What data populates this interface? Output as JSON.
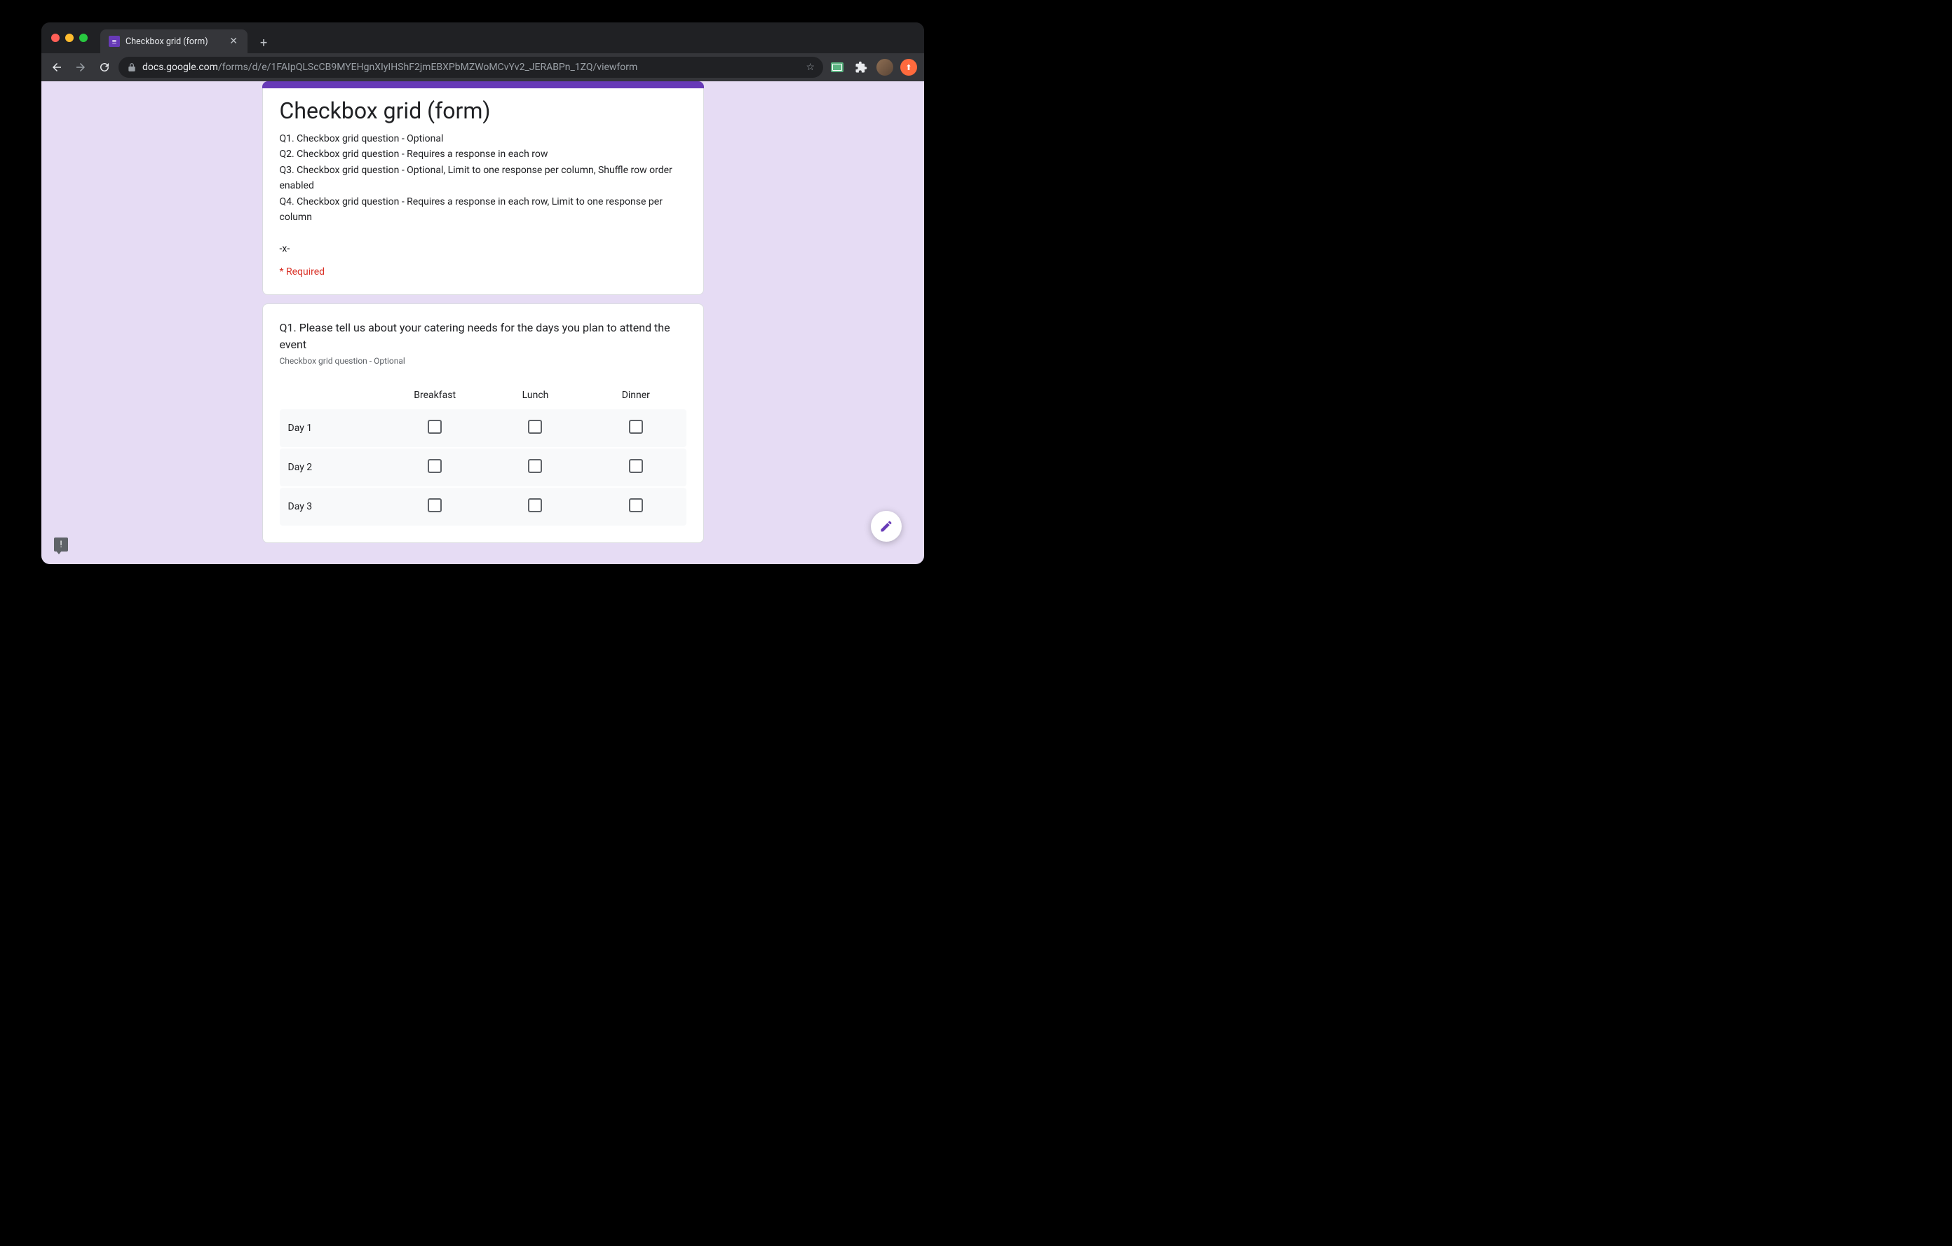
{
  "browser": {
    "tab_title": "Checkbox grid (form)",
    "url_domain": "docs.google.com",
    "url_path": "/forms/d/e/1FAIpQLScCB9MYEHgnXIyIHShF2jmEBXPbMZWoMCvYv2_JERABPn_1ZQ/viewform"
  },
  "form": {
    "title": "Checkbox grid (form)",
    "description": "Q1. Checkbox grid question - Optional\nQ2. Checkbox grid question - Requires a response in each row\nQ3. Checkbox grid question - Optional, Limit to one response per column, Shuffle row order enabled\nQ4. Checkbox grid question - Requires a response in each row, Limit to one response per column\n\n-x-",
    "required_label": "* Required"
  },
  "q1": {
    "title": "Q1. Please tell us about your catering needs for the days you plan to attend the event",
    "subtitle": "Checkbox grid question - Optional",
    "columns": [
      "Breakfast",
      "Lunch",
      "Dinner"
    ],
    "rows": [
      "Day 1",
      "Day 2",
      "Day 3"
    ]
  }
}
